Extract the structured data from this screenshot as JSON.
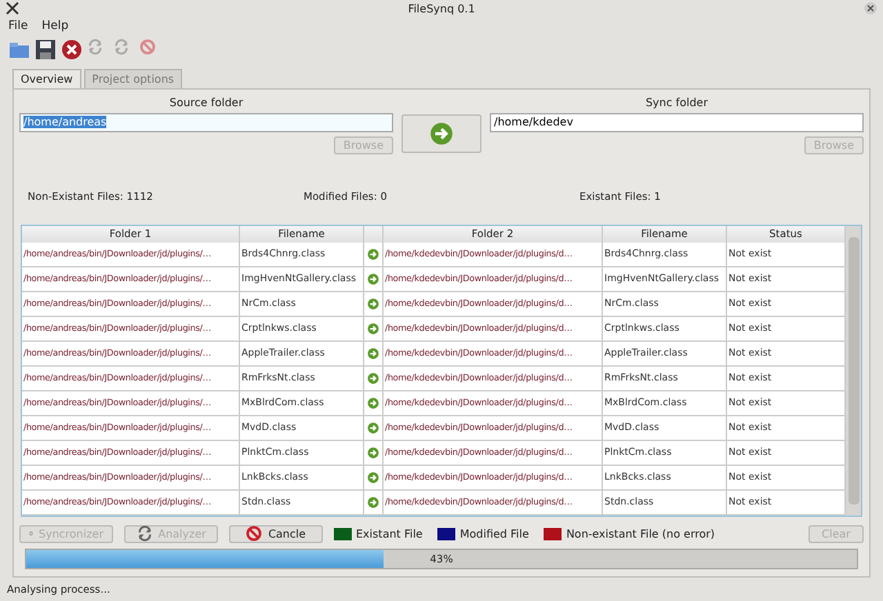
{
  "window": {
    "title": "FileSynq 0.1"
  },
  "menu": [
    "File",
    "Help"
  ],
  "toolbar": [
    {
      "kind": "open",
      "disabled": false
    },
    {
      "kind": "save",
      "disabled": false
    },
    {
      "kind": "close",
      "disabled": false
    },
    {
      "kind": "sync",
      "disabled": true
    },
    {
      "kind": "sync",
      "disabled": true
    },
    {
      "kind": "stop",
      "disabled": true
    }
  ],
  "tabs": [
    {
      "label": "Overview",
      "selected": true,
      "disabled": false
    },
    {
      "label": "Project options",
      "selected": false,
      "disabled": true
    }
  ],
  "source": {
    "label": "Source folder",
    "value": "/home/andreas",
    "browse": "Browse",
    "browse_disabled": true
  },
  "sync": {
    "label": "Sync folder",
    "value": "/home/kdedev",
    "browse": "Browse",
    "browse_disabled": true
  },
  "counts": [
    "Non-Existant Files: 1112",
    "Modified Files: 0",
    "Existant Files: 1"
  ],
  "table": {
    "columns": [
      "Folder 1",
      "Filename",
      "",
      "Folder 2",
      "Filename",
      "Status"
    ],
    "rows": [
      {
        "folder1": "/home/andreas/bin/JDownloader/jd/plugins/…",
        "file1": "Brds4Chnrg.class",
        "folder2": "/home/kdedevbin/JDownloader/jd/plugins/d…",
        "file2": "Brds4Chnrg.class",
        "status": "Not exist"
      },
      {
        "folder1": "/home/andreas/bin/JDownloader/jd/plugins/…",
        "file1": "ImgHvenNtGallery.class",
        "folder2": "/home/kdedevbin/JDownloader/jd/plugins/d…",
        "file2": "ImgHvenNtGallery.class",
        "status": "Not exist"
      },
      {
        "folder1": "/home/andreas/bin/JDownloader/jd/plugins/…",
        "file1": "NrCm.class",
        "folder2": "/home/kdedevbin/JDownloader/jd/plugins/d…",
        "file2": "NrCm.class",
        "status": "Not exist"
      },
      {
        "folder1": "/home/andreas/bin/JDownloader/jd/plugins/…",
        "file1": "Crptlnkws.class",
        "folder2": "/home/kdedevbin/JDownloader/jd/plugins/d…",
        "file2": "Crptlnkws.class",
        "status": "Not exist"
      },
      {
        "folder1": "/home/andreas/bin/JDownloader/jd/plugins/…",
        "file1": "AppleTrailer.class",
        "folder2": "/home/kdedevbin/JDownloader/jd/plugins/d…",
        "file2": "AppleTrailer.class",
        "status": "Not exist"
      },
      {
        "folder1": "/home/andreas/bin/JDownloader/jd/plugins/…",
        "file1": "RmFrksNt.class",
        "folder2": "/home/kdedevbin/JDownloader/jd/plugins/d…",
        "file2": "RmFrksNt.class",
        "status": "Not exist"
      },
      {
        "folder1": "/home/andreas/bin/JDownloader/jd/plugins/…",
        "file1": "MxBlrdCom.class",
        "folder2": "/home/kdedevbin/JDownloader/jd/plugins/d…",
        "file2": "MxBlrdCom.class",
        "status": "Not exist"
      },
      {
        "folder1": "/home/andreas/bin/JDownloader/jd/plugins/…",
        "file1": "MvdD.class",
        "folder2": "/home/kdedevbin/JDownloader/jd/plugins/d…",
        "file2": "MvdD.class",
        "status": "Not exist"
      },
      {
        "folder1": "/home/andreas/bin/JDownloader/jd/plugins/…",
        "file1": "PlnktCm.class",
        "folder2": "/home/kdedevbin/JDownloader/jd/plugins/d…",
        "file2": "PlnktCm.class",
        "status": "Not exist"
      },
      {
        "folder1": "/home/andreas/bin/JDownloader/jd/plugins/…",
        "file1": "LnkBcks.class",
        "folder2": "/home/kdedevbin/JDownloader/jd/plugins/d…",
        "file2": "LnkBcks.class",
        "status": "Not exist"
      },
      {
        "folder1": "/home/andreas/bin/JDownloader/jd/plugins/…",
        "file1": "Stdn.class",
        "folder2": "/home/kdedevbin/JDownloader/jd/plugins/d…",
        "file2": "Stdn.class",
        "status": "Not exist"
      }
    ]
  },
  "actions": [
    {
      "label": "Syncronizer",
      "kind": "sync",
      "disabled": true
    },
    {
      "label": "Analyzer",
      "kind": "sync",
      "disabled": true
    },
    {
      "label": "Cancle",
      "kind": "stop",
      "disabled": false
    }
  ],
  "legend": [
    {
      "label": "Existant File",
      "color": "#0b5e1a"
    },
    {
      "label": "Modified File",
      "color": "#0c0c84"
    },
    {
      "label": "Non-existant File (no error)",
      "color": "#b0101a"
    }
  ],
  "clear": {
    "label": "Clear",
    "disabled": true
  },
  "progress": {
    "level": 0.43,
    "reading": "43%"
  },
  "status_bar": "Analysing process..."
}
